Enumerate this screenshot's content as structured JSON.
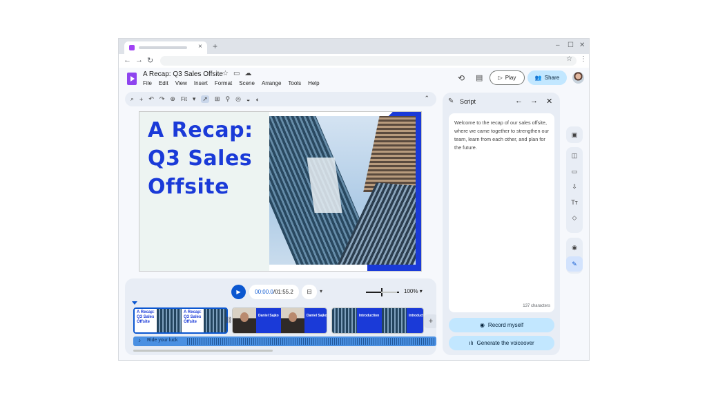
{
  "browser": {
    "new_tab": "+",
    "close_tab": "×",
    "min": "–",
    "max": "☐",
    "close": "✕",
    "back": "←",
    "forward": "→",
    "reload": "↻",
    "bookmark": "☆",
    "menu": "⋮"
  },
  "doc": {
    "title": "A Recap: Q3 Sales Offsite",
    "menu": [
      "File",
      "Edit",
      "View",
      "Insert",
      "Format",
      "Scene",
      "Arrange",
      "Tools",
      "Help"
    ],
    "play_label": "Play",
    "share_label": "Share"
  },
  "toolbar": {
    "zoom_fit": "Fit"
  },
  "slide": {
    "title": "A Recap: Q3 Sales Offsite"
  },
  "timeline": {
    "current_time": "00:00.0",
    "separator": " / ",
    "duration": "01:55.2",
    "zoom": "100%",
    "clips": [
      {
        "title": "A Recap: Q3 Sales Offsite"
      },
      {
        "caption": "Daniel Sajko"
      },
      {
        "caption": "Introduction"
      }
    ],
    "audio_track": "Ride your luck"
  },
  "script": {
    "panel_title": "Script",
    "text": "Welcome to the recap of our sales offsite, where we came together to strengthen our team, learn from each other, and plan for the future.",
    "char_count": "137 characters",
    "record_label": "Record myself",
    "voiceover_label": "Generate the voiceover"
  },
  "colors": {
    "accent": "#0b57d0",
    "brand_blue": "#1a3ad8",
    "share_bg": "#c2e7ff",
    "app_purple": "#8e44ef"
  }
}
